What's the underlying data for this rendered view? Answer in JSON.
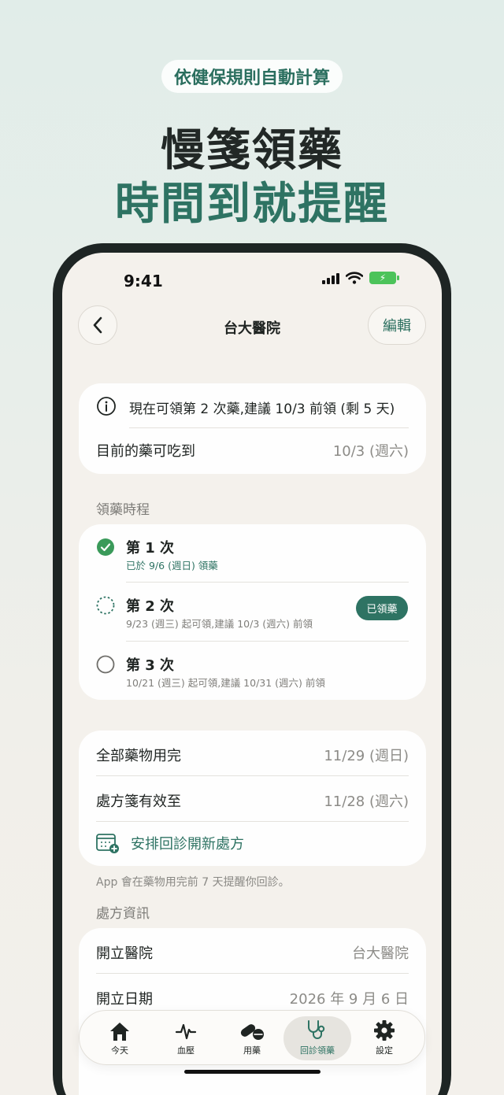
{
  "promo": {
    "pill": "依健保規則自動計算",
    "headline_line1": "慢箋領藥",
    "headline_line2": "時間到就提醒"
  },
  "status_bar": {
    "time": "9:41"
  },
  "nav": {
    "title": "台大醫院",
    "edit_label": "編輯"
  },
  "summary": {
    "info_text": "現在可領第 2 次藥,建議 10/3 前領 (剩 5 天)",
    "rows": [
      {
        "label": "目前的藥可吃到",
        "value": "10/3 (週六)"
      }
    ]
  },
  "schedule": {
    "section_title": "領藥時程",
    "steps": [
      {
        "title": "第 1 次",
        "subtitle": "已於 9/6 (週日) 領藥",
        "state": "done"
      },
      {
        "title": "第 2 次",
        "subtitle": "9/23 (週三) 起可領,建議 10/3 (週六) 前領",
        "state": "current",
        "badge": "已領藥"
      },
      {
        "title": "第 3 次",
        "subtitle": "10/21 (週三) 起可領,建議 10/31 (週六) 前領",
        "state": "pending"
      }
    ]
  },
  "refill": {
    "rows": [
      {
        "label": "全部藥物用完",
        "value": "11/29 (週日)"
      },
      {
        "label": "處方箋有效至",
        "value": "11/28 (週六)"
      }
    ],
    "action_label": "安排回診開新處方",
    "note": "App 會在藥物用完前 7 天提醒你回診。"
  },
  "prescription": {
    "section_title": "處方資訊",
    "rows": [
      {
        "label": "開立醫院",
        "value": "台大醫院"
      },
      {
        "label": "開立日期",
        "value": "2026 年 9 月 6 日"
      }
    ]
  },
  "tabbar": {
    "items": [
      {
        "label": "今天",
        "icon": "home-icon"
      },
      {
        "label": "血壓",
        "icon": "pulse-icon"
      },
      {
        "label": "用藥",
        "icon": "pills-icon"
      },
      {
        "label": "回診領藥",
        "icon": "stethoscope-icon",
        "active": true
      },
      {
        "label": "設定",
        "icon": "gear-icon"
      }
    ]
  },
  "colors": {
    "accent": "#2e7363",
    "done_green": "#3a9a5a",
    "background": "#f4f1ec"
  }
}
